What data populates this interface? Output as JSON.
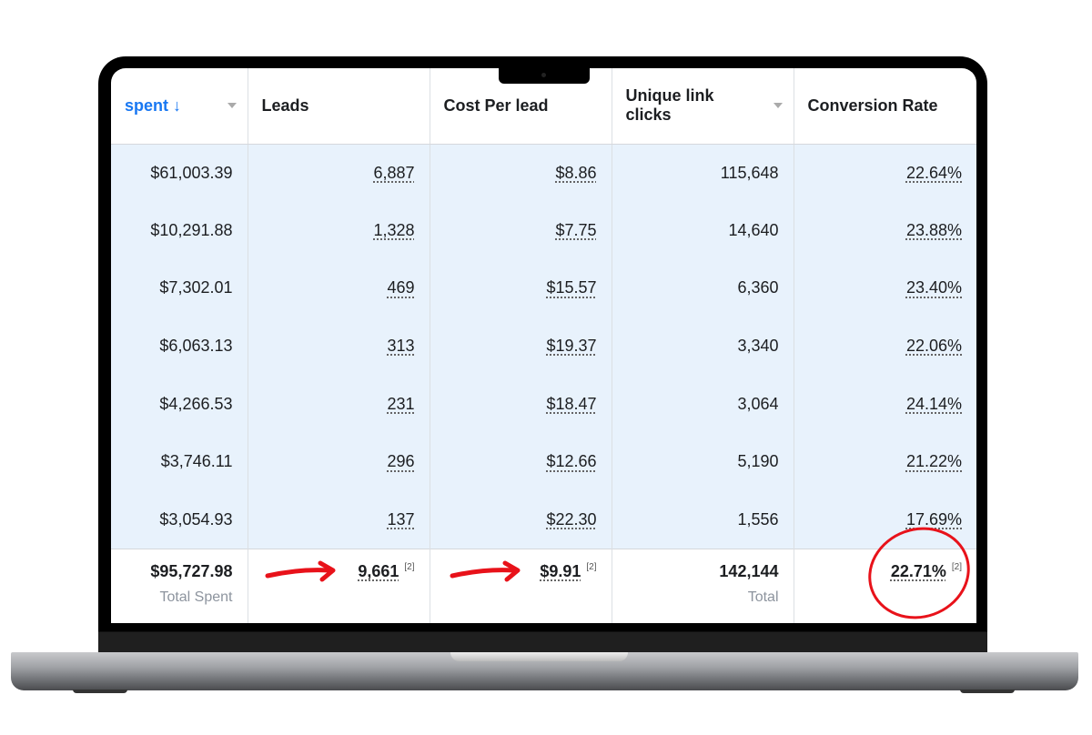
{
  "columns": [
    {
      "label": "spent",
      "sort_icon": "arrow-down-icon",
      "sorted": true,
      "dropdown": true
    },
    {
      "label": "Leads"
    },
    {
      "label": "Cost Per lead"
    },
    {
      "label": "Unique link clicks",
      "dropdown": true
    },
    {
      "label": "Conversion Rate"
    }
  ],
  "rows": [
    [
      "$61,003.39",
      "6,887",
      "$8.86",
      "115,648",
      "22.64%"
    ],
    [
      "$10,291.88",
      "1,328",
      "$7.75",
      "14,640",
      "23.88%"
    ],
    [
      "$7,302.01",
      "469",
      "$15.57",
      "6,360",
      "23.40%"
    ],
    [
      "$6,063.13",
      "313",
      "$19.37",
      "3,340",
      "22.06%"
    ],
    [
      "$4,266.53",
      "231",
      "$18.47",
      "3,064",
      "24.14%"
    ],
    [
      "$3,746.11",
      "296",
      "$12.66",
      "5,190",
      "21.22%"
    ],
    [
      "$3,054.93",
      "137",
      "$22.30",
      "1,556",
      "17.69%"
    ]
  ],
  "totals": {
    "spent": "$95,727.98",
    "spent_label": "Total Spent",
    "leads": "9,661",
    "leads_note": "[2]",
    "cpl": "$9.91",
    "cpl_note": "[2]",
    "clicks": "142,144",
    "clicks_label": "Total",
    "conv": "22.71%",
    "conv_note": "[2]"
  },
  "colors": {
    "accent": "#1877f2",
    "row_bg": "#e8f2fc",
    "annotation": "#e8121a"
  }
}
